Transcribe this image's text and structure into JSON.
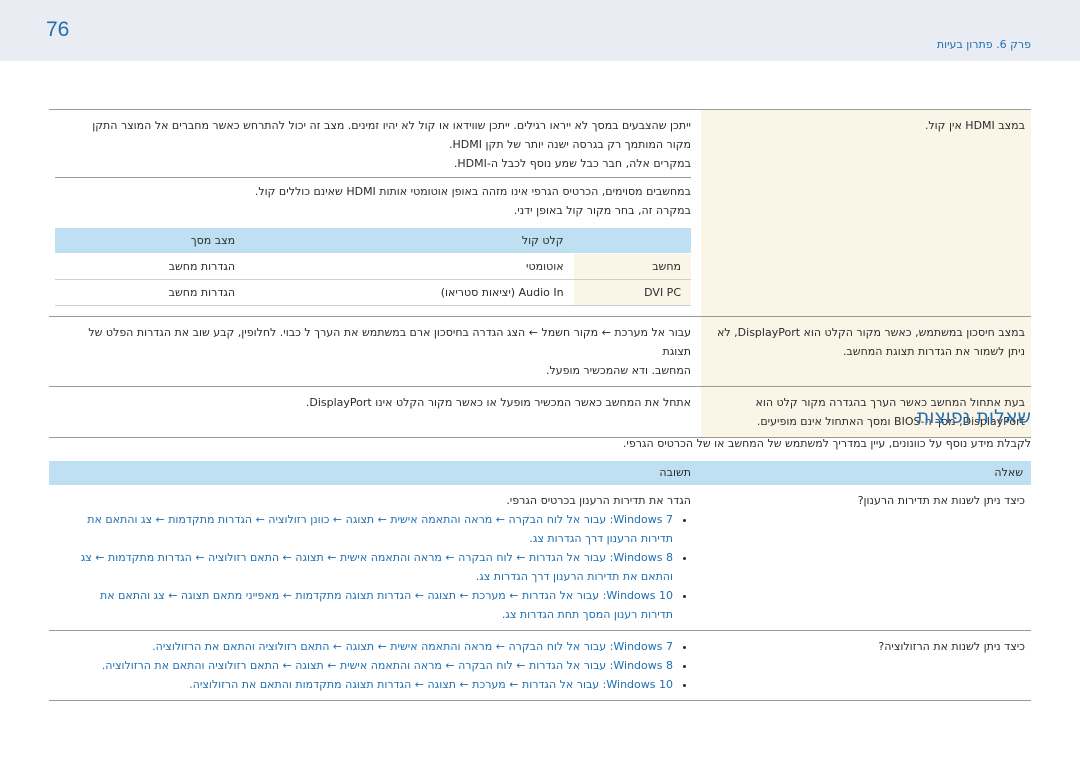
{
  "header": {
    "page_number": "76",
    "chapter": "פרק 6. פתרון בעיות"
  },
  "table1": {
    "rows": [
      {
        "question": "במצב HDMI אין קול.",
        "answer_blocks": [
          [
            "ייתכן שהצבעים במסך לא ייראו רגילים. ייתכן שווידאו או קול לא יהיו זמינים. מצב זה יכול להתרחש כאשר מחברים אל המוצר התקן",
            "מקור המותמך רק בגרסה ישנה יותר של תקן HDMI.",
            "במקרים אלה, חבר כבל שמע נוסף לכבל ה-HDMI."
          ],
          [
            "במחשבים מסוימים, הכרטיס הגרפי אינו מזהה באופן אוטומטי אותות HDMI שאינם כוללים קול.",
            "במקרה זה, בחר מקור קול באופן ידני."
          ]
        ],
        "subtable": {
          "headers": [
            "",
            "קלט קול",
            "מצב מסך"
          ],
          "rows": [
            [
              "מחשב",
              "אוטומטי",
              "הגדרות מחשב"
            ],
            [
              "DVI PC",
              "Audio In (יציאות סטריאו)",
              "הגדרות מחשב"
            ]
          ]
        }
      },
      {
        "question": [
          "במצב חיסכון במשתמש, כאשר מקור הקלט הוא DisplayPort, לא",
          "ניתן לשמור את הגדרות תצוגת המחשב."
        ],
        "answer": [
          "עבור אל מערכת ← מקור חשמל ← הצג הגדרה בחיסכון ארם במשתמש את הערך ל כבוי. לחלופין, קבע שוב את הגדרות הפלט של תצוגת",
          "המחשב. ודא שהמכשיר מופעל."
        ]
      },
      {
        "question": [
          "בעת אתחול המחשב כאשר הערך בהגדרה מקור קלט הוא",
          "DisplayPort, מסך ה-BIOS ומסך האתחול אינם מופיעים."
        ],
        "answer": [
          "אתחל את המחשב כאשר המכשיר מופעל או כאשר מקור הקלט אינו DisplayPort."
        ]
      }
    ]
  },
  "faq": {
    "title": "שאלות נפוצות",
    "intro": "לקבלת מידע נוסף על כוונונים, עיין במדריך למשתמש של המחשב או של הכרטיס הגרפי.",
    "headers": {
      "question": "שאלה",
      "answer": "תשובה"
    },
    "rows": [
      {
        "question": "כיצד ניתן לשנות את תדירות הרענון?",
        "intro": "הגדר את תדירות הרענון בכרטיס הגרפי.",
        "items": [
          [
            "Windows 7: עבור אל לוח הבקרה ← מראה והתאמה אישית ← תצוגה ← כוונן רזולוציה ← הגדרות מתקדמות ← צג והתאם את",
            "תדירות הרענון דרך הגדרות צג."
          ],
          [
            "Windows 8: עבור אל הגדרות ← לוח הבקרה ← מראה והתאמה אישית ← תצוגה ← התאם רזולוציה ← הגדרות מתקדמות ← צג",
            "והתאם את תדירות הרענון דרך הגדרות צג."
          ],
          [
            "Windows 10: עבור אל הגדרות ← מערכת ← תצוגה ← הגדרות תצוגה מתקדמות ← מאפייני מתאם תצוגה ← צג והתאם את",
            "תדירות רענון המסך תחת הגדרות צג."
          ]
        ]
      },
      {
        "question": "כיצד ניתן לשנות את הרזולוציה?",
        "items": [
          [
            "Windows 7: עבור אל לוח הבקרה ← מראה והתאמה אישית ← תצוגה ← התאם רזולוציה והתאם את הרזולוציה."
          ],
          [
            "Windows 8: עבור אל הגדרות ← לוח הבקרה ← מראה והתאמה אישית ← תצוגה ← התאם רזולוציה והתאם את הרזולוציה."
          ],
          [
            "Windows 10: עבור אל הגדרות ← מערכת ← תצוגה ← הגדרות תצוגה מתקדמות והתאם את הרזולוציה."
          ]
        ]
      }
    ]
  }
}
